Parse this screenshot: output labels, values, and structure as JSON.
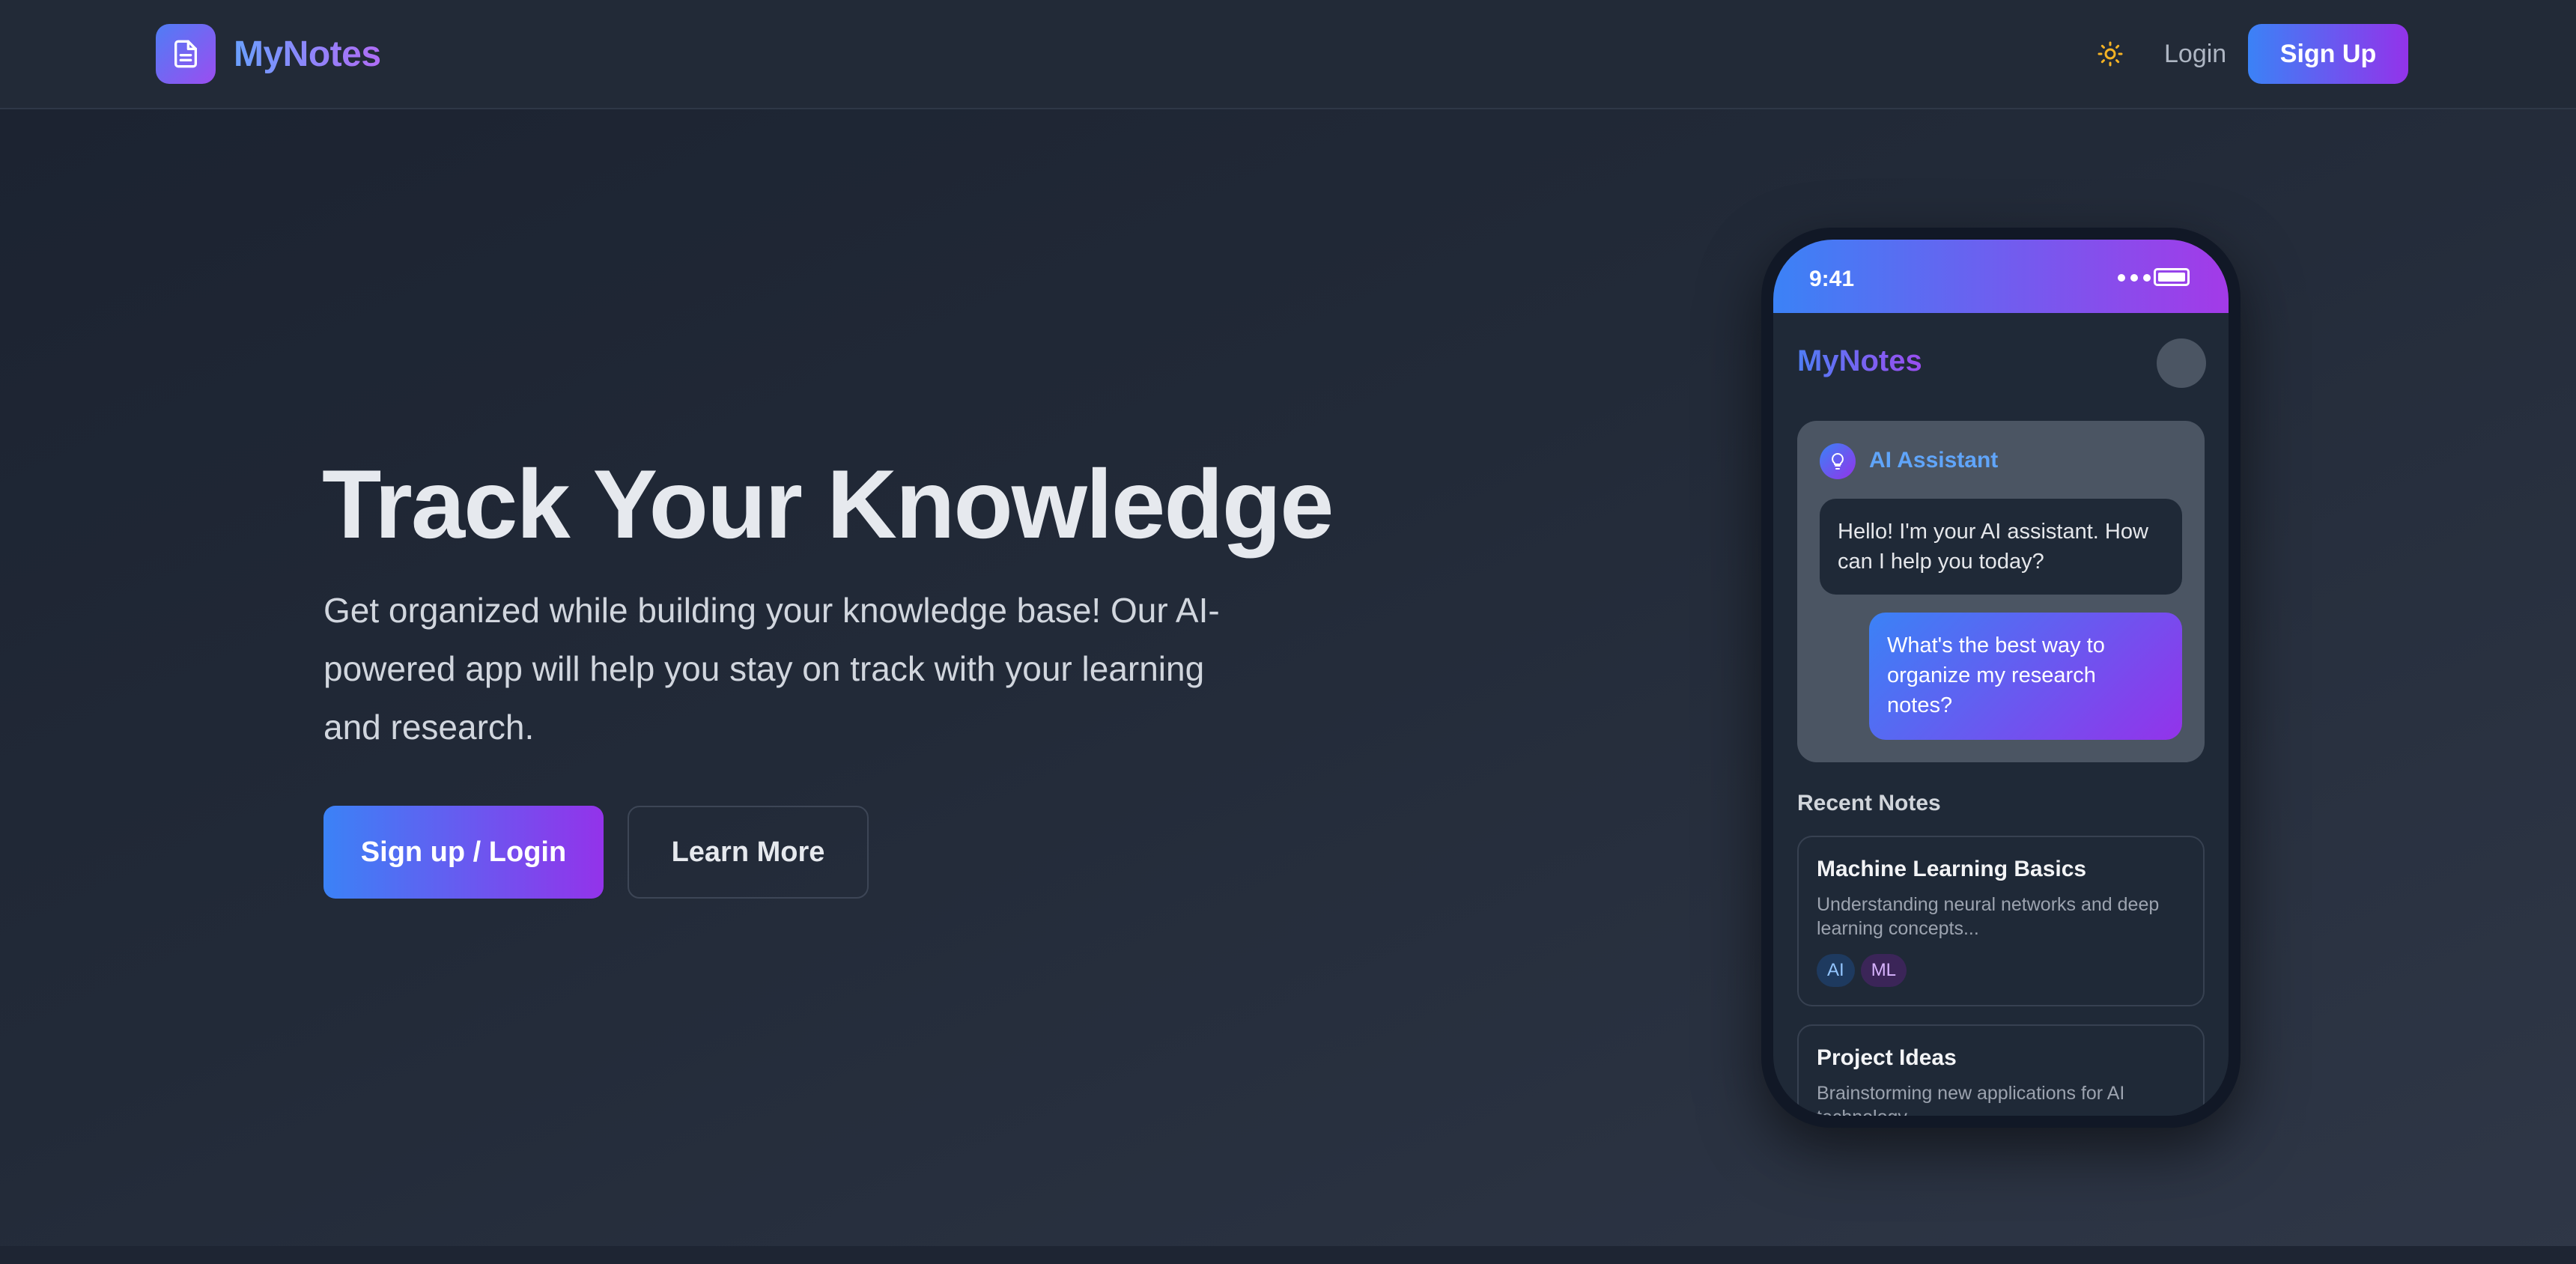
{
  "colors": {
    "accent_blue": "#3b82f6",
    "accent_purple": "#9333ea",
    "background": "#1f2633",
    "text_primary": "#e6e9ee",
    "sun_icon": "#f5b324"
  },
  "nav": {
    "brand_name": "MyNotes",
    "brand_icon": "document-icon",
    "theme_icon": "sun-icon",
    "login_label": "Login",
    "signup_label": "Sign Up"
  },
  "hero": {
    "title": "Track Your Knowledge",
    "subtitle": "Get organized while building your knowledge base! Our AI-powered app will help you stay on track with your learning and research.",
    "primary_cta": "Sign up / Login",
    "secondary_cta": "Learn More"
  },
  "phone": {
    "time": "9:41",
    "app_title": "MyNotes",
    "assistant": {
      "label": "AI Assistant",
      "icon": "lightbulb-icon",
      "ai_message": "Hello! I'm your AI assistant. How can I help you today?",
      "user_message": "What's the best way to organize my research notes?"
    },
    "recent_heading": "Recent Notes",
    "notes": [
      {
        "title": "Machine Learning Basics",
        "snippet": "Understanding neural networks and deep learning concepts...",
        "tags": [
          "AI",
          "ML"
        ]
      },
      {
        "title": "Project Ideas",
        "snippet": "Brainstorming new applications for AI technology..."
      }
    ]
  }
}
